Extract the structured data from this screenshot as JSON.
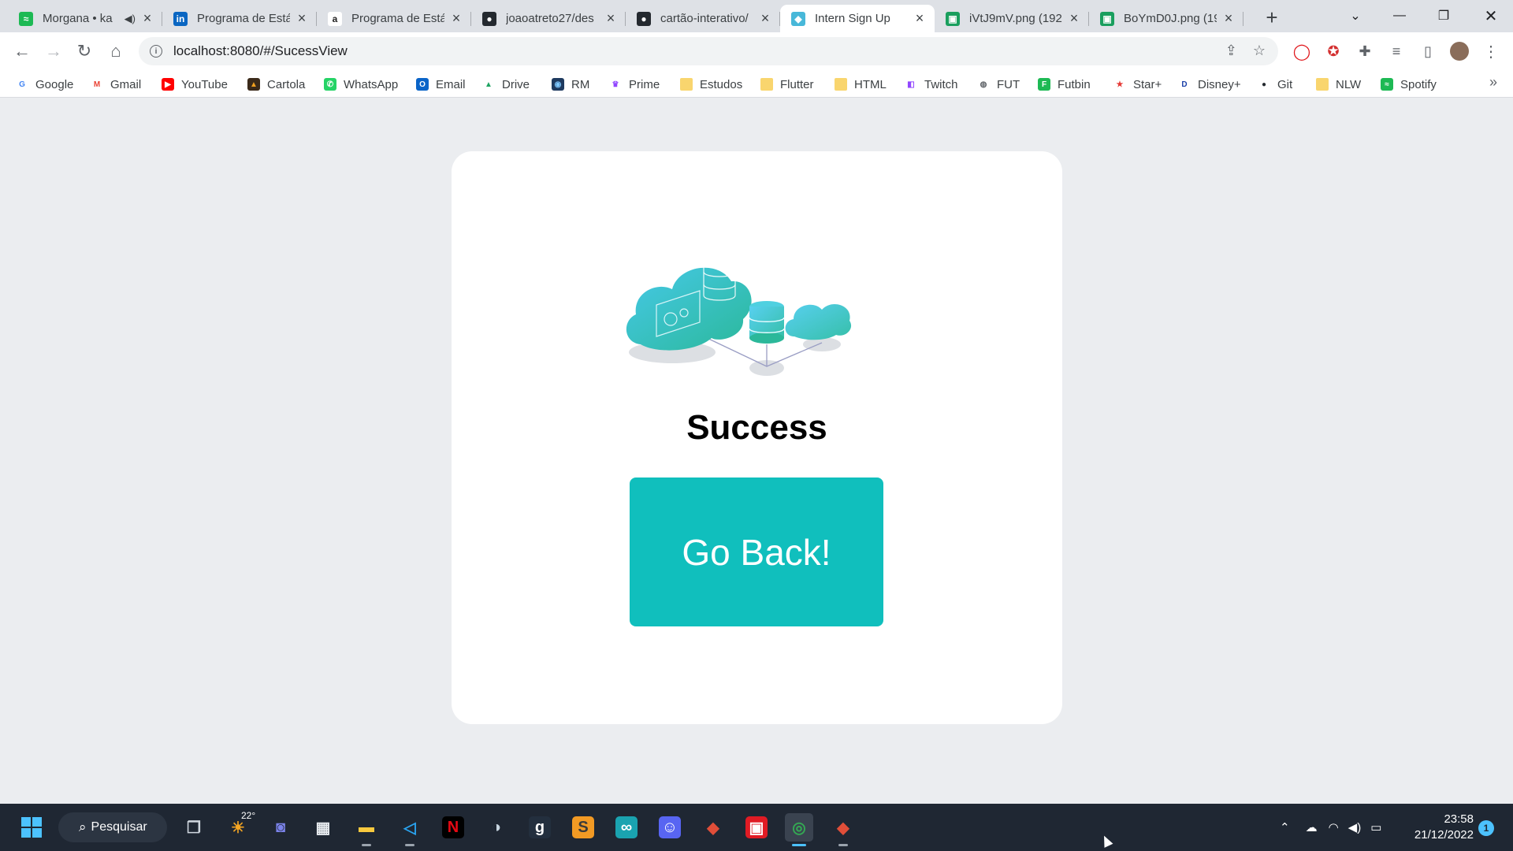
{
  "browser": {
    "tabs": [
      {
        "title": "Morgana • ka",
        "icon": "spotify-icon",
        "color": "#1db954",
        "glyph": "≈",
        "audio": true
      },
      {
        "title": "Programa de Está",
        "icon": "linkedin-icon",
        "color": "#0a66c2",
        "glyph": "in"
      },
      {
        "title": "Programa de Está",
        "icon": "amazon-icon",
        "color": "#ffffff",
        "glyph": "a"
      },
      {
        "title": "joaoatreto27/des",
        "icon": "github-icon",
        "color": "#24292f",
        "glyph": "●"
      },
      {
        "title": "cartão-interativo/",
        "icon": "github-icon",
        "color": "#24292f",
        "glyph": "●"
      },
      {
        "title": "Intern Sign Up",
        "icon": "app-icon",
        "color": "#48b8d9",
        "glyph": "◆",
        "active": true
      },
      {
        "title": "iVtJ9mV.png (192",
        "icon": "image-icon",
        "color": "#1a9f5e",
        "glyph": "▣"
      },
      {
        "title": "BoYmD0J.png (19",
        "icon": "image-icon",
        "color": "#1a9f5e",
        "glyph": "▣"
      }
    ],
    "new_tab_label": "+",
    "url": "localhost:8080/#/SucessView",
    "bookmarks": [
      {
        "label": "Google",
        "icon": "google-icon",
        "color": "#ffffff",
        "glyph": "G",
        "fg": "#4285f4"
      },
      {
        "label": "Gmail",
        "icon": "gmail-icon",
        "color": "#ffffff",
        "glyph": "M",
        "fg": "#ea4335"
      },
      {
        "label": "YouTube",
        "icon": "youtube-icon",
        "color": "#ff0000",
        "glyph": "▶",
        "fg": "#ffffff"
      },
      {
        "label": "Cartola",
        "icon": "cartola-icon",
        "color": "#3b2a1a",
        "glyph": "▲",
        "fg": "#f0a020"
      },
      {
        "label": "WhatsApp",
        "icon": "whatsapp-icon",
        "color": "#25d366",
        "glyph": "✆",
        "fg": "#ffffff"
      },
      {
        "label": "Email",
        "icon": "outlook-icon",
        "color": "#0a64c8",
        "glyph": "O",
        "fg": "#ffffff"
      },
      {
        "label": "Drive",
        "icon": "drive-icon",
        "color": "#ffffff",
        "glyph": "▲",
        "fg": "#1fa463"
      },
      {
        "label": "RM",
        "icon": "rm-icon",
        "color": "#1e3a5f",
        "glyph": "◉",
        "fg": "#7ec8ff"
      },
      {
        "label": "Prime",
        "icon": "prime-icon",
        "color": "#ffffff",
        "glyph": "♛",
        "fg": "#9146ff"
      },
      {
        "label": "Estudos",
        "icon": "folder-icon",
        "folder": true
      },
      {
        "label": "Flutter",
        "icon": "folder-icon",
        "folder": true
      },
      {
        "label": "HTML",
        "icon": "folder-icon",
        "folder": true
      },
      {
        "label": "Twitch",
        "icon": "twitch-icon",
        "color": "#ffffff",
        "glyph": "◧",
        "fg": "#9146ff"
      },
      {
        "label": "FUT",
        "icon": "globe-icon",
        "color": "#ffffff",
        "glyph": "◍",
        "fg": "#5f6368"
      },
      {
        "label": "Futbin",
        "icon": "futbin-icon",
        "color": "#1db954",
        "glyph": "F",
        "fg": "#ffffff"
      },
      {
        "label": "Star+",
        "icon": "star-plus-icon",
        "color": "#ffffff",
        "glyph": "★",
        "fg": "#e53935"
      },
      {
        "label": "Disney+",
        "icon": "disney-icon",
        "color": "#ffffff",
        "glyph": "D",
        "fg": "#1a3fa8"
      },
      {
        "label": "Git",
        "icon": "github-icon",
        "color": "#ffffff",
        "glyph": "●",
        "fg": "#24292f"
      },
      {
        "label": "NLW",
        "icon": "folder-icon",
        "folder": true
      },
      {
        "label": "Spotify",
        "icon": "spotify-icon",
        "color": "#1db954",
        "glyph": "≈",
        "fg": "#ffffff"
      }
    ],
    "more_bookmarks": "»"
  },
  "page": {
    "title": "Success",
    "button_label": "Go Back!"
  },
  "taskbar": {
    "search_label": "Pesquisar",
    "weather": "22°",
    "apps": [
      {
        "name": "task-view-icon",
        "glyph": "❐",
        "bg": "transparent",
        "fg": "#cfd6de"
      },
      {
        "name": "weather-icon",
        "glyph": "☀",
        "bg": "transparent",
        "fg": "#f5a623"
      },
      {
        "name": "teams-chat-icon",
        "glyph": "◙",
        "bg": "transparent",
        "fg": "#7b83eb"
      },
      {
        "name": "store-icon",
        "glyph": "▦",
        "bg": "transparent",
        "fg": "#e8ecf0"
      },
      {
        "name": "file-explorer-icon",
        "glyph": "▬",
        "bg": "transparent",
        "fg": "#f8c93e",
        "running": true
      },
      {
        "name": "vscode-icon",
        "glyph": "◁",
        "bg": "transparent",
        "fg": "#2aa3ef",
        "running": true
      },
      {
        "name": "netflix-icon",
        "glyph": "N",
        "bg": "#000000",
        "fg": "#e50914"
      },
      {
        "name": "steam-icon",
        "glyph": "◑",
        "bg": "transparent",
        "fg": "#c7d5e0"
      },
      {
        "name": "amazon-games-icon",
        "glyph": "g",
        "bg": "#232f3e",
        "fg": "#ffffff"
      },
      {
        "name": "sublime-icon",
        "glyph": "S",
        "bg": "#f29a24",
        "fg": "#3a3a3a"
      },
      {
        "name": "arduino-icon",
        "glyph": "∞",
        "bg": "#1aa3b0",
        "fg": "#ffffff"
      },
      {
        "name": "discord-icon",
        "glyph": "☺",
        "bg": "#5865f2",
        "fg": "#ffffff"
      },
      {
        "name": "git-kraken-icon",
        "glyph": "◆",
        "bg": "transparent",
        "fg": "#e04e39"
      },
      {
        "name": "office-icon",
        "glyph": "▣",
        "bg": "#e01b24",
        "fg": "#ffffff"
      },
      {
        "name": "chrome-icon",
        "glyph": "◎",
        "bg": "transparent",
        "fg": "#34a853",
        "active": true
      },
      {
        "name": "git-gui-icon",
        "glyph": "◆",
        "bg": "transparent",
        "fg": "#e04e39",
        "running": true
      }
    ],
    "time": "23:58",
    "date": "21/12/2022",
    "notifications": "1"
  }
}
